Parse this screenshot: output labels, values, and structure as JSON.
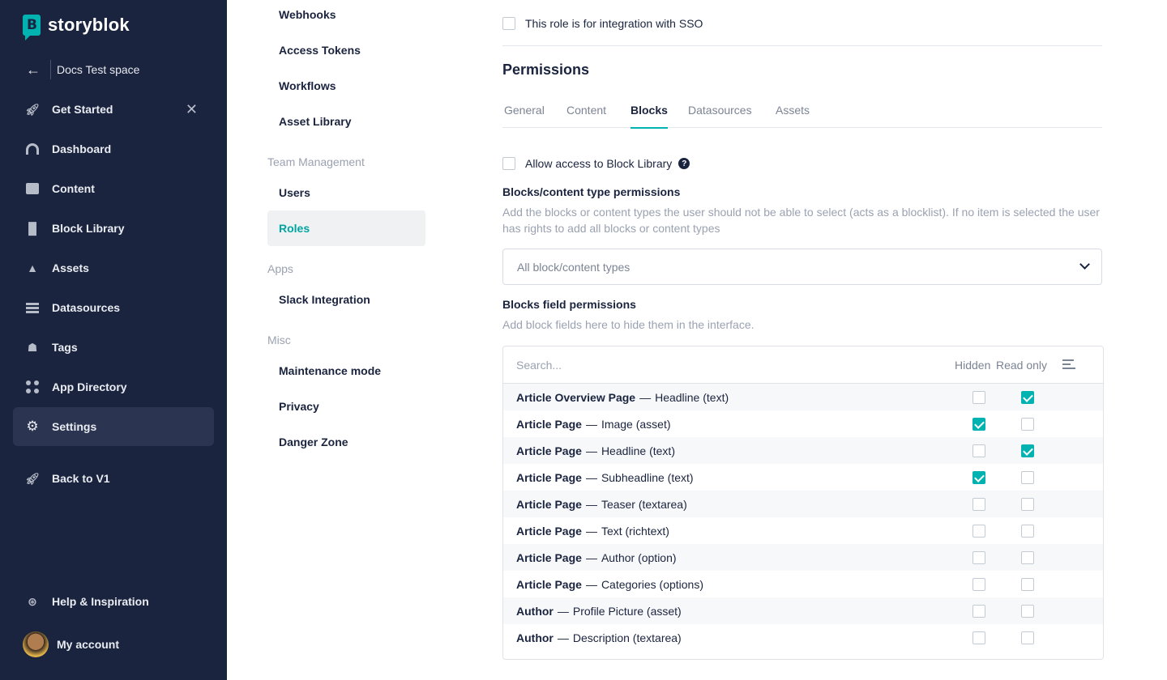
{
  "brand": {
    "name": "storyblok"
  },
  "space": {
    "name": "Docs Test space"
  },
  "sidebar": {
    "items": [
      {
        "label": "Get Started",
        "icon": "rocket-icon"
      },
      {
        "label": "Dashboard",
        "icon": "dashboard-icon"
      },
      {
        "label": "Content",
        "icon": "content-icon"
      },
      {
        "label": "Block Library",
        "icon": "block-library-icon"
      },
      {
        "label": "Assets",
        "icon": "assets-icon"
      },
      {
        "label": "Datasources",
        "icon": "datasources-icon"
      },
      {
        "label": "Tags",
        "icon": "tag-icon"
      },
      {
        "label": "App Directory",
        "icon": "apps-icon"
      },
      {
        "label": "Settings",
        "icon": "gear-icon"
      },
      {
        "label": "Back to V1",
        "icon": "rocket-icon"
      }
    ],
    "help": "Help & Inspiration",
    "account": "My account",
    "active": "Settings"
  },
  "subnav": {
    "items_top": [
      "Webhooks",
      "Access Tokens",
      "Workflows",
      "Asset Library"
    ],
    "team_heading": "Team Management",
    "team_items": [
      "Users",
      "Roles"
    ],
    "apps_heading": "Apps",
    "apps_items": [
      "Slack Integration"
    ],
    "misc_heading": "Misc",
    "misc_items": [
      "Maintenance mode",
      "Privacy",
      "Danger Zone"
    ],
    "active": "Roles"
  },
  "main": {
    "sso_label": "This role is for integration with SSO",
    "permissions_title": "Permissions",
    "tabs": [
      "General",
      "Content",
      "Blocks",
      "Datasources",
      "Assets"
    ],
    "active_tab": "Blocks",
    "allow_block_library": "Allow access to Block Library",
    "blocks_perm_title": "Blocks/content type permissions",
    "blocks_perm_desc": "Add the blocks or content types the user should not be able to select (acts as a blocklist). If no item is selected the user has rights to add all blocks or content types",
    "select_placeholder": "All block/content types",
    "field_perm_title": "Blocks field permissions",
    "field_perm_desc": "Add block fields here to hide them in the interface.",
    "table": {
      "search_placeholder": "Search...",
      "col_hidden": "Hidden",
      "col_readonly": "Read only",
      "rows": [
        {
          "block": "Article Overview Page",
          "field": "Headline (text)",
          "hidden": false,
          "readonly": true
        },
        {
          "block": "Article Page",
          "field": "Image (asset)",
          "hidden": true,
          "readonly": false
        },
        {
          "block": "Article Page",
          "field": "Headline (text)",
          "hidden": false,
          "readonly": true
        },
        {
          "block": "Article Page",
          "field": "Subheadline (text)",
          "hidden": true,
          "readonly": false
        },
        {
          "block": "Article Page",
          "field": "Teaser (textarea)",
          "hidden": false,
          "readonly": false
        },
        {
          "block": "Article Page",
          "field": "Text (richtext)",
          "hidden": false,
          "readonly": false
        },
        {
          "block": "Article Page",
          "field": "Author (option)",
          "hidden": false,
          "readonly": false
        },
        {
          "block": "Article Page",
          "field": "Categories (options)",
          "hidden": false,
          "readonly": false
        },
        {
          "block": "Author",
          "field": "Profile Picture (asset)",
          "hidden": false,
          "readonly": false
        },
        {
          "block": "Author",
          "field": "Description (textarea)",
          "hidden": false,
          "readonly": false
        }
      ]
    }
  },
  "colors": {
    "sidebar_bg": "#1b243f",
    "accent": "#00b3b0"
  }
}
